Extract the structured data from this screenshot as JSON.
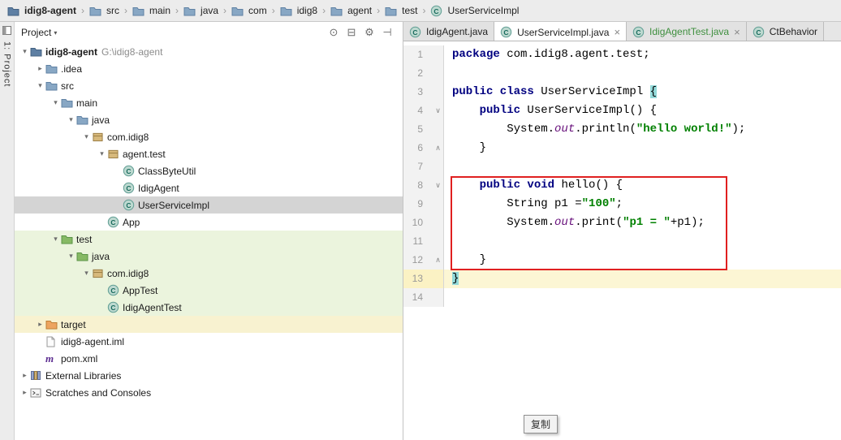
{
  "breadcrumb_bar": {
    "separator": "›",
    "items": [
      {
        "label": "idig8-agent",
        "icon": "folder-root",
        "bold": true
      },
      {
        "label": "src",
        "icon": "folder"
      },
      {
        "label": "main",
        "icon": "folder"
      },
      {
        "label": "java",
        "icon": "folder"
      },
      {
        "label": "com",
        "icon": "folder"
      },
      {
        "label": "idig8",
        "icon": "folder"
      },
      {
        "label": "agent",
        "icon": "folder"
      },
      {
        "label": "test",
        "icon": "folder"
      },
      {
        "label": "UserServiceImpl",
        "icon": "class"
      }
    ]
  },
  "tool_strip": {
    "label": "1: Project"
  },
  "project_panel": {
    "header": {
      "title": "Project",
      "caret": "▾",
      "icons": [
        {
          "name": "locate",
          "glyph": "⊙"
        },
        {
          "name": "collapse-all",
          "glyph": "⊟"
        },
        {
          "name": "settings",
          "glyph": "⚙"
        },
        {
          "name": "hide",
          "glyph": "⊣"
        }
      ]
    },
    "tree": [
      {
        "indent": 0,
        "chevron": "down",
        "icon": "folder-root",
        "label": "idig8-agent",
        "sublabel": "G:\\idig8-agent",
        "bold": true
      },
      {
        "indent": 1,
        "chevron": "right",
        "icon": "folder",
        "label": ".idea"
      },
      {
        "indent": 1,
        "chevron": "down",
        "icon": "folder",
        "label": "src"
      },
      {
        "indent": 2,
        "chevron": "down",
        "icon": "folder",
        "label": "main"
      },
      {
        "indent": 3,
        "chevron": "down",
        "icon": "folder",
        "label": "java"
      },
      {
        "indent": 4,
        "chevron": "down",
        "icon": "package",
        "label": "com.idig8"
      },
      {
        "indent": 5,
        "chevron": "down",
        "icon": "package",
        "label": "agent.test"
      },
      {
        "indent": 6,
        "chevron": "none",
        "icon": "class",
        "label": "ClassByteUtil"
      },
      {
        "indent": 6,
        "chevron": "none",
        "icon": "class",
        "label": "IdigAgent"
      },
      {
        "indent": 6,
        "chevron": "none",
        "icon": "class",
        "label": "UserServiceImpl",
        "state": "selected"
      },
      {
        "indent": 5,
        "chevron": "none",
        "icon": "class",
        "label": "App"
      },
      {
        "indent": 2,
        "chevron": "down",
        "icon": "folder-test",
        "label": "test",
        "state": "test-scope"
      },
      {
        "indent": 3,
        "chevron": "down",
        "icon": "folder-test",
        "label": "java",
        "state": "test-scope"
      },
      {
        "indent": 4,
        "chevron": "down",
        "icon": "package",
        "label": "com.idig8",
        "state": "test-scope"
      },
      {
        "indent": 5,
        "chevron": "none",
        "icon": "class",
        "label": "AppTest",
        "state": "test-scope"
      },
      {
        "indent": 5,
        "chevron": "none",
        "icon": "class",
        "label": "IdigAgentTest",
        "state": "test-scope"
      },
      {
        "indent": 1,
        "chevron": "right",
        "icon": "folder-excluded",
        "label": "target",
        "state": "excluded-scope"
      },
      {
        "indent": 1,
        "chevron": "none",
        "icon": "file",
        "label": "idig8-agent.iml"
      },
      {
        "indent": 1,
        "chevron": "none",
        "icon": "maven",
        "label": "pom.xml"
      },
      {
        "indent": 0,
        "chevron": "right",
        "icon": "libraries",
        "label": "External Libraries"
      },
      {
        "indent": 0,
        "chevron": "right",
        "icon": "consoles",
        "label": "Scratches and Consoles"
      }
    ]
  },
  "editor": {
    "tabs": [
      {
        "label": "IdigAgent.java",
        "active": false,
        "test": false,
        "close": false
      },
      {
        "label": "UserServiceImpl.java",
        "active": true,
        "test": false,
        "close": true
      },
      {
        "label": "IdigAgentTest.java",
        "active": false,
        "test": true,
        "close": true
      },
      {
        "label": "CtBehavior",
        "active": false,
        "test": false,
        "close": false
      }
    ],
    "code": {
      "current_line": 13,
      "folds": {
        "4": "down",
        "6": "up",
        "8": "down",
        "12": "up"
      },
      "lines": [
        {
          "n": 1,
          "tokens": [
            {
              "t": "package ",
              "c": "kw"
            },
            {
              "t": "com.idig8.agent.test;",
              "c": "pl"
            }
          ]
        },
        {
          "n": 2,
          "tokens": []
        },
        {
          "n": 3,
          "tokens": [
            {
              "t": "public class ",
              "c": "kw"
            },
            {
              "t": "UserServiceImpl ",
              "c": "pl"
            },
            {
              "t": "{",
              "c": "brace"
            }
          ]
        },
        {
          "n": 4,
          "tokens": [
            {
              "t": "    ",
              "c": "pl"
            },
            {
              "t": "public ",
              "c": "kw"
            },
            {
              "t": "UserServiceImpl() {",
              "c": "pl"
            }
          ]
        },
        {
          "n": 5,
          "tokens": [
            {
              "t": "        System.",
              "c": "pl"
            },
            {
              "t": "out",
              "c": "fld"
            },
            {
              "t": ".println(",
              "c": "pl"
            },
            {
              "t": "\"hello world!\"",
              "c": "str"
            },
            {
              "t": ");",
              "c": "pl"
            }
          ]
        },
        {
          "n": 6,
          "tokens": [
            {
              "t": "    }",
              "c": "pl"
            }
          ]
        },
        {
          "n": 7,
          "tokens": []
        },
        {
          "n": 8,
          "tokens": [
            {
              "t": "    ",
              "c": "pl"
            },
            {
              "t": "public void ",
              "c": "kw"
            },
            {
              "t": "hello() {",
              "c": "pl"
            }
          ]
        },
        {
          "n": 9,
          "tokens": [
            {
              "t": "        String p1 =",
              "c": "pl"
            },
            {
              "t": "\"100\"",
              "c": "str"
            },
            {
              "t": ";",
              "c": "pl"
            }
          ]
        },
        {
          "n": 10,
          "tokens": [
            {
              "t": "        System.",
              "c": "pl"
            },
            {
              "t": "out",
              "c": "fld"
            },
            {
              "t": ".print(",
              "c": "pl"
            },
            {
              "t": "\"p1 = \"",
              "c": "str"
            },
            {
              "t": "+p1);",
              "c": "pl"
            }
          ]
        },
        {
          "n": 11,
          "tokens": []
        },
        {
          "n": 12,
          "tokens": [
            {
              "t": "    }",
              "c": "pl"
            }
          ]
        },
        {
          "n": 13,
          "tokens": [
            {
              "t": "}",
              "c": "brace"
            }
          ]
        },
        {
          "n": 14,
          "tokens": []
        }
      ]
    }
  },
  "tooltip": {
    "text": "复制"
  },
  "colors": {
    "keyword": "#000080",
    "string": "#008000",
    "static_field": "#660E7A",
    "brace_match_bg": "#93d9d9",
    "current_line_bg": "#fcf6d4",
    "selection_bg": "#d4d4d4",
    "test_scope_bg": "#ebf4dd",
    "excluded_scope_bg": "#f8f2d0",
    "annotation": "#e02020"
  }
}
